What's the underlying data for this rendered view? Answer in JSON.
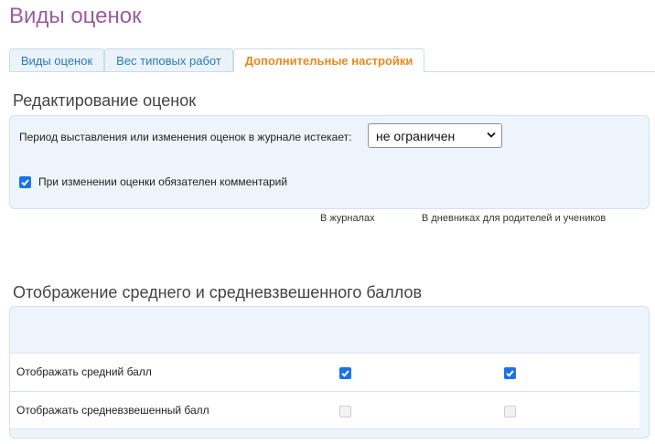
{
  "page": {
    "title": "Виды оценок"
  },
  "tabs": [
    {
      "label": "Виды оценок",
      "active": false
    },
    {
      "label": "Вес типовых работ",
      "active": false
    },
    {
      "label": "Дополнительные настройки",
      "active": true
    }
  ],
  "grade_editing": {
    "title": "Редактирование оценок",
    "period_label": "Период выставления или изменения оценок в журнале истекает:",
    "period_select": {
      "value": "не ограничен"
    },
    "comment_required": {
      "label": "При изменении оценки обязателен комментарий",
      "checked": true
    }
  },
  "average_display": {
    "title": "Отображение среднего и средневзвешенного баллов",
    "columns": [
      "В журналах",
      "В дневниках для родителей и учеников"
    ],
    "rows": [
      {
        "label": "Отображать средний балл",
        "journals": true,
        "diaries": true,
        "enabled": true
      },
      {
        "label": "Отображать средневзвешенный балл",
        "journals": false,
        "diaries": false,
        "enabled": false
      }
    ]
  },
  "colors": {
    "title": "#9b5c9e",
    "tab_text": "#2a7ab8",
    "tab_active": "#e8891f",
    "checkbox": "#1a73e8",
    "panel_bg": "#eef4fb"
  },
  "icons": {
    "select_arrow": "chevron-down-icon",
    "check": "checkmark-icon"
  }
}
